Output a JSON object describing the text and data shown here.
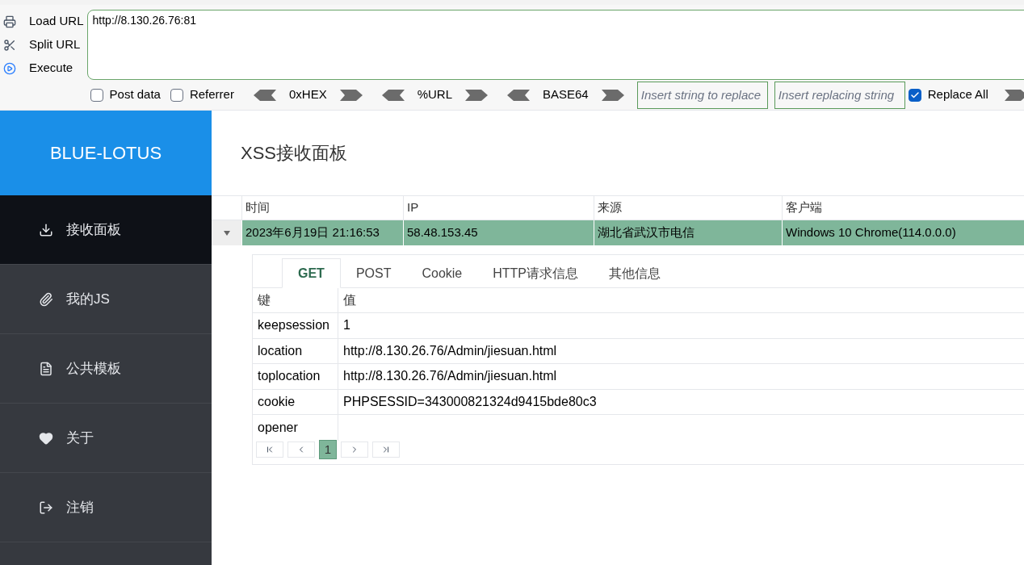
{
  "toolbar": {
    "actions": [
      {
        "kind": "load",
        "label": "Load URL"
      },
      {
        "kind": "split",
        "label": "Split URL"
      },
      {
        "kind": "execute",
        "label": "Execute"
      }
    ],
    "url": "http://8.130.26.76:81",
    "options": [
      {
        "kind": "checkbox",
        "label": "Post data",
        "checked": false
      },
      {
        "kind": "checkbox",
        "label": "Referrer",
        "checked": false
      },
      {
        "kind": "encoder",
        "label": "0xHEX"
      },
      {
        "kind": "encoder",
        "label": "%URL"
      },
      {
        "kind": "encoder",
        "label": "BASE64"
      },
      {
        "kind": "field",
        "placeholder": "Insert string to replace"
      },
      {
        "kind": "field",
        "placeholder": "Insert replacing string"
      },
      {
        "kind": "checkbox",
        "label": "Replace All",
        "checked": true
      },
      {
        "kind": "arrow"
      }
    ]
  },
  "sidebar": {
    "brand": "BLUE-LOTUS",
    "items": [
      {
        "label": "接收面板",
        "selected": true
      },
      {
        "label": "我的JS",
        "selected": false
      },
      {
        "label": "公共模板",
        "selected": false
      },
      {
        "label": "关于",
        "selected": false
      },
      {
        "label": "注销",
        "selected": false
      }
    ]
  },
  "page_title": "XSS接收面板",
  "table": {
    "columns": [
      "时间",
      "IP",
      "来源",
      "客户端"
    ],
    "rows": [
      {
        "expanded": true,
        "cells": [
          "2023年6月19日 21:16:53",
          "58.48.153.45",
          "湖北省武汉市电信",
          "Windows 10 Chrome(114.0.0.0)"
        ]
      }
    ]
  },
  "detail": {
    "tabs": [
      {
        "label": "GET",
        "selected": true
      },
      {
        "label": "POST",
        "selected": false
      },
      {
        "label": "Cookie",
        "selected": false
      },
      {
        "label": "HTTP请求信息",
        "selected": false
      },
      {
        "label": "其他信息",
        "selected": false
      }
    ],
    "columns": [
      "键",
      "值"
    ],
    "rows": [
      [
        "keepsession",
        "1"
      ],
      [
        "location",
        "http://8.130.26.76/Admin/jiesuan.html"
      ],
      [
        "toplocation",
        "http://8.130.26.76/Admin/jiesuan.html"
      ],
      [
        "cookie",
        "PHPSESSID=343000821324d9415bde80c3"
      ],
      [
        "opener"
      ]
    ],
    "pages": [
      {
        "label": "1",
        "selected": true
      }
    ]
  }
}
